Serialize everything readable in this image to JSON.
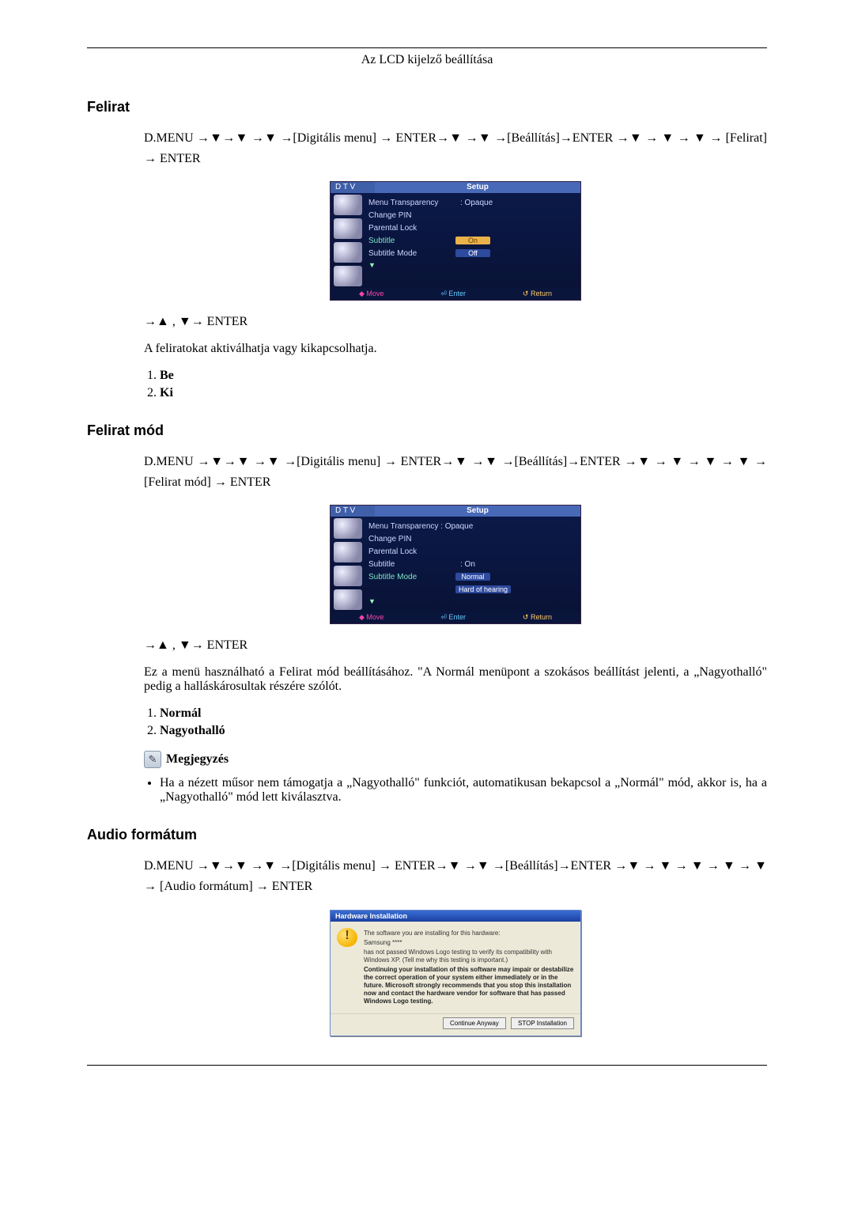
{
  "page_header": "Az LCD kijelző beállítása",
  "s1": {
    "title": "Felirat",
    "nav": "D.MENU →▼→▼ →▼ →[Digitális menu] → ENTER→▼ →▼ →[Beállítás]→ENTER →▼ → ▼ → ▼ → [Felirat] → ENTER",
    "post_nav": "→▲ , ▼→ ENTER",
    "desc": "A feliratokat aktiválhatja vagy kikapcsolhatja.",
    "opt1": "Be",
    "opt2": "Ki"
  },
  "s2": {
    "title": "Felirat mód",
    "nav": "D.MENU →▼→▼ →▼ →[Digitális menu] → ENTER→▼ →▼ →[Beállítás]→ENTER →▼ → ▼ → ▼ → ▼ → [Felirat mód] → ENTER",
    "post_nav": "→▲ , ▼→ ENTER",
    "desc": "Ez a menü használható a Felirat mód beállításához. \"A Normál menüpont a szokásos beállítást jelenti, a „Nagyothalló\" pedig a halláskárosultak részére szólót.",
    "opt1": "Normál",
    "opt2": "Nagyothalló",
    "note_label": "Megjegyzés",
    "note_bullet": "Ha a nézett műsor nem támogatja a „Nagyothalló\" funkciót, automatikusan bekapcsol a „Normál\" mód, akkor is, ha a „Nagyothalló\" mód lett kiválasztva."
  },
  "s3": {
    "title": "Audio formátum",
    "nav": "D.MENU →▼→▼ →▼ →[Digitális menu] → ENTER→▼ →▼ →[Beállítás]→ENTER →▼ → ▼ → ▼ → ▼ → ▼ → [Audio formátum] → ENTER"
  },
  "osd1": {
    "dtv": "D T V",
    "setup": "Setup",
    "r1": "Menu Transparency",
    "r1v": ": Opaque",
    "r2": "Change PIN",
    "r3": "Parental Lock",
    "r4": "Subtitle",
    "r4_on": "On",
    "r4_off": "Off",
    "r5": "Subtitle Mode",
    "f_move": "◆ Move",
    "f_enter": "⏎ Enter",
    "f_return": "↺ Return"
  },
  "osd2": {
    "dtv": "D T V",
    "setup": "Setup",
    "r1": "Menu Transparency : Opaque",
    "r2": "Change PIN",
    "r3": "Parental Lock",
    "r4": "Subtitle",
    "r4v": ": On",
    "r5": "Subtitle Mode",
    "r5_normal": "Normal",
    "r5_hoh": "Hard of hearing",
    "f_move": "◆ Move",
    "f_enter": "⏎ Enter",
    "f_return": "↺ Return"
  },
  "win": {
    "title": "Hardware Installation",
    "l1": "The software you are installing for this hardware:",
    "l2": "Samsung ****",
    "l3": "has not passed Windows Logo testing to verify its compatibility with Windows XP. (Tell me why this testing is important.)",
    "l4": "Continuing your installation of this software may impair or destabilize the correct operation of your system either immediately or in the future. Microsoft strongly recommends that you stop this installation now and contact the hardware vendor for software that has passed Windows Logo testing.",
    "btn1": "Continue Anyway",
    "btn2": "STOP Installation"
  }
}
